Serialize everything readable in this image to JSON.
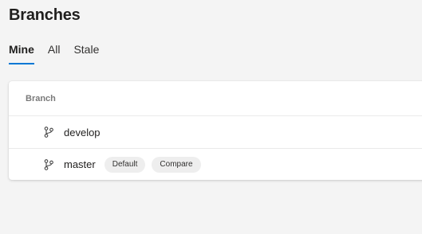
{
  "page": {
    "title": "Branches"
  },
  "tabs": [
    {
      "label": "Mine",
      "active": true
    },
    {
      "label": "All",
      "active": false
    },
    {
      "label": "Stale",
      "active": false
    }
  ],
  "table": {
    "column_header": "Branch",
    "rows": [
      {
        "name": "develop",
        "icon": "branch-icon",
        "badges": []
      },
      {
        "name": "master",
        "icon": "branch-icon",
        "badges": [
          "Default",
          "Compare"
        ]
      }
    ]
  },
  "colors": {
    "accent": "#0078d4",
    "background": "#f4f4f4",
    "card": "#ffffff"
  }
}
